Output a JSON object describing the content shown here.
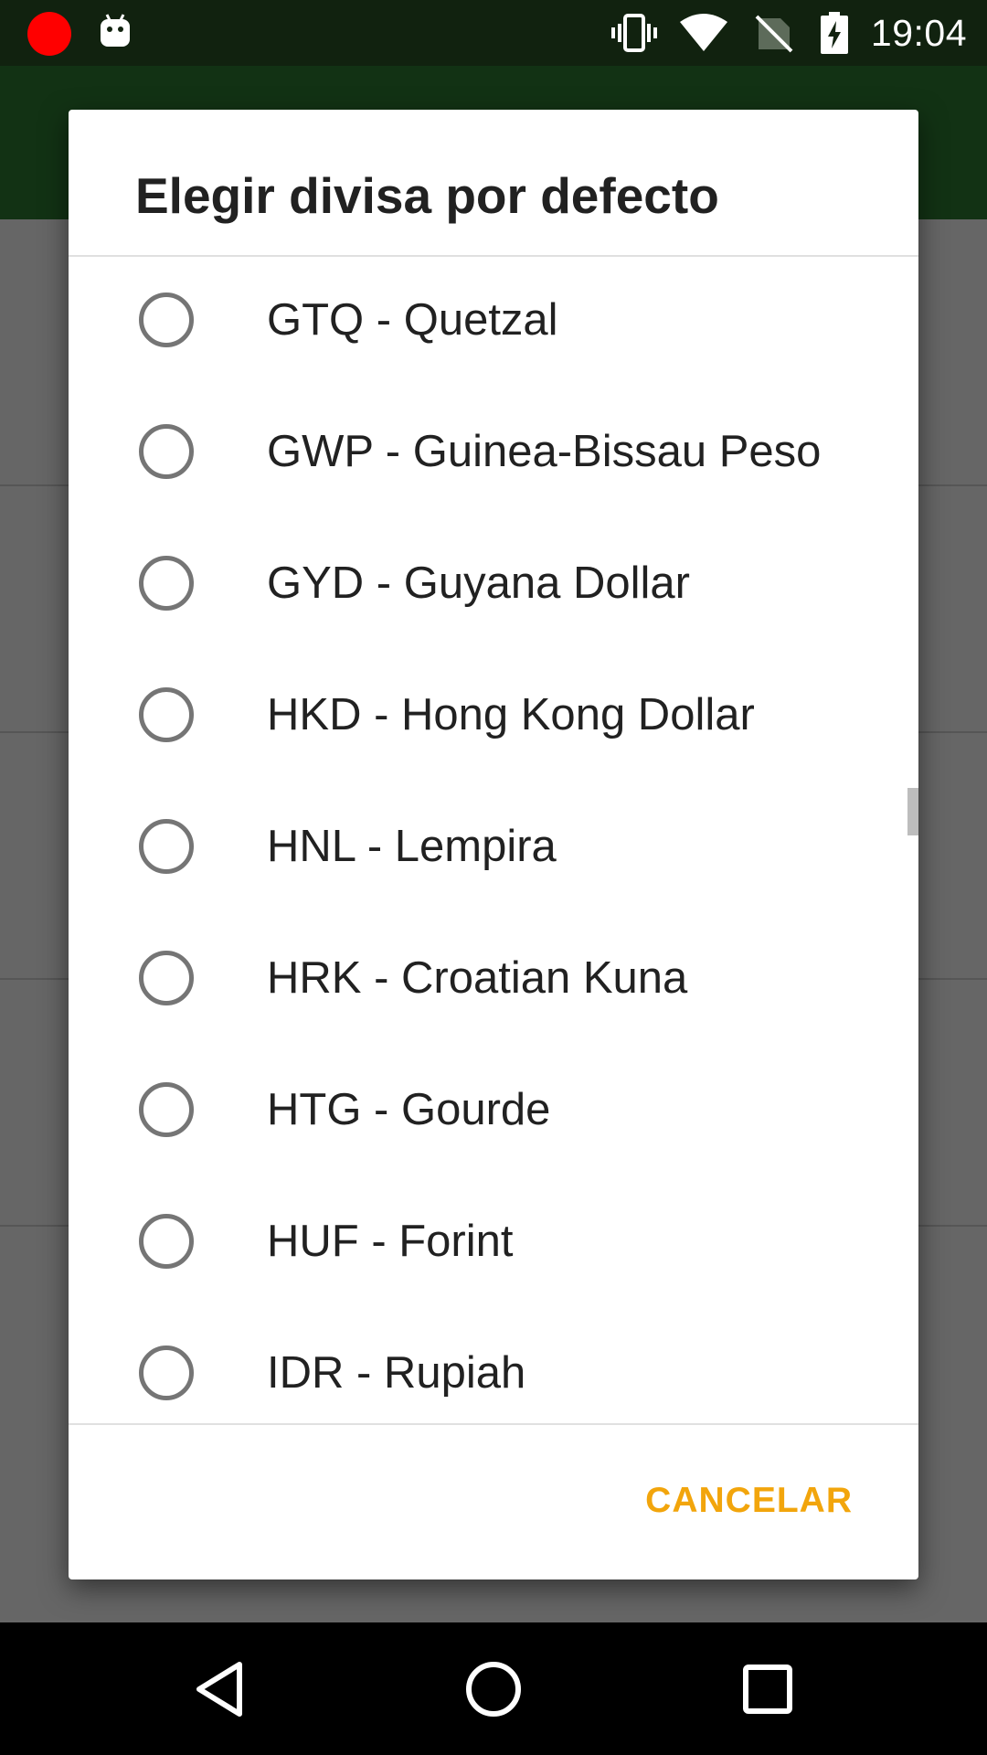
{
  "status_bar": {
    "time": "19:04",
    "icons": [
      "record-icon",
      "android-icon",
      "vibrate-icon",
      "wifi-icon",
      "no-sim-icon",
      "battery-charging-icon"
    ]
  },
  "dialog": {
    "title": "Elegir divisa por defecto",
    "items": [
      {
        "label": "GTQ - Quetzal",
        "selected": false
      },
      {
        "label": "GWP - Guinea-Bissau Peso",
        "selected": false
      },
      {
        "label": "GYD - Guyana Dollar",
        "selected": false
      },
      {
        "label": "HKD - Hong Kong Dollar",
        "selected": false
      },
      {
        "label": "HNL - Lempira",
        "selected": false
      },
      {
        "label": "HRK - Croatian Kuna",
        "selected": false
      },
      {
        "label": "HTG - Gourde",
        "selected": false
      },
      {
        "label": "HUF - Forint",
        "selected": false
      },
      {
        "label": "IDR - Rupiah",
        "selected": false
      }
    ],
    "cancel_label": "CANCELAR"
  },
  "nav_bar": {
    "icons": [
      "back-icon",
      "home-icon",
      "recents-icon"
    ]
  },
  "colors": {
    "accent": "#f2a50c",
    "toolbar": "#2e7d32",
    "status_bar": "#11220f"
  }
}
